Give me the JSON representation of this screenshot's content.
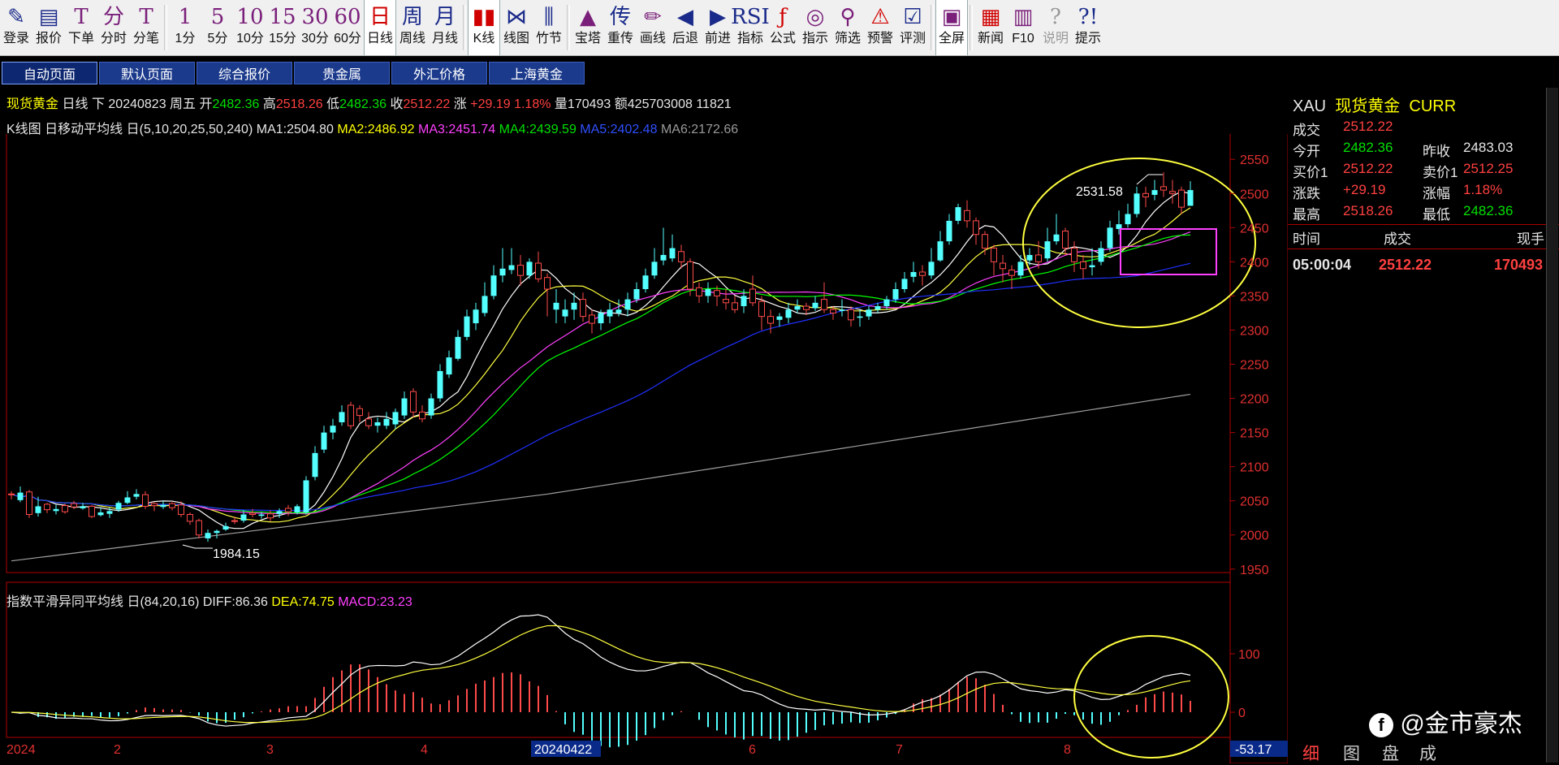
{
  "toolbar": {
    "buttons": [
      {
        "icon": "✎",
        "label": "登录",
        "name": "login",
        "style": "navy"
      },
      {
        "icon": "▤",
        "label": "报价",
        "name": "quote",
        "style": "navy"
      },
      {
        "icon": "T",
        "label": "下单",
        "name": "order",
        "style": ""
      },
      {
        "icon": "分",
        "label": "分时",
        "name": "intraday",
        "style": ""
      },
      {
        "icon": "T",
        "label": "分笔",
        "name": "ticks",
        "style": ""
      },
      {
        "icon": "1",
        "label": "1分",
        "name": "1min",
        "style": ""
      },
      {
        "icon": "5",
        "label": "5分",
        "name": "5min",
        "style": ""
      },
      {
        "icon": "10",
        "label": "10分",
        "name": "10min",
        "style": ""
      },
      {
        "icon": "15",
        "label": "15分",
        "name": "15min",
        "style": ""
      },
      {
        "icon": "30",
        "label": "30分",
        "name": "30min",
        "style": ""
      },
      {
        "icon": "60",
        "label": "60分",
        "name": "60min",
        "style": ""
      },
      {
        "icon": "日",
        "label": "日线",
        "name": "daily",
        "style": "red active"
      },
      {
        "icon": "周",
        "label": "周线",
        "name": "weekly",
        "style": "navy"
      },
      {
        "icon": "月",
        "label": "月线",
        "name": "monthly",
        "style": "navy"
      },
      {
        "icon": "▮▮",
        "label": "K线",
        "name": "kline",
        "style": "red active"
      },
      {
        "icon": "⋈",
        "label": "线图",
        "name": "linechart",
        "style": "navy"
      },
      {
        "icon": "⫼",
        "label": "竹节",
        "name": "bamboo",
        "style": "navy"
      },
      {
        "icon": "▲",
        "label": "宝塔",
        "name": "tower",
        "style": ""
      },
      {
        "icon": "传",
        "label": "重传",
        "name": "reload",
        "style": "navy"
      },
      {
        "icon": "✏",
        "label": "画线",
        "name": "draw",
        "style": ""
      },
      {
        "icon": "◀",
        "label": "后退",
        "name": "back",
        "style": "navy"
      },
      {
        "icon": "▶",
        "label": "前进",
        "name": "forward",
        "style": "navy"
      },
      {
        "icon": "RSI",
        "label": "指标",
        "name": "indicator",
        "style": "navy"
      },
      {
        "icon": "ƒ",
        "label": "公式",
        "name": "formula",
        "style": "red"
      },
      {
        "icon": "◎",
        "label": "指示",
        "name": "indicate",
        "style": ""
      },
      {
        "icon": "⚲",
        "label": "筛选",
        "name": "filter",
        "style": ""
      },
      {
        "icon": "⚠",
        "label": "预警",
        "name": "alert",
        "style": "red"
      },
      {
        "icon": "☑",
        "label": "评测",
        "name": "evaluate",
        "style": "navy"
      },
      {
        "icon": "▣",
        "label": "全屏",
        "name": "fullscreen",
        "style": "active"
      },
      {
        "icon": "▦",
        "label": "新闻",
        "name": "news",
        "style": "red"
      },
      {
        "icon": "▥",
        "label": "F10",
        "name": "f10",
        "style": ""
      },
      {
        "icon": "?",
        "label": "说明",
        "name": "help",
        "style": "grey"
      },
      {
        "icon": "?!",
        "label": "提示",
        "name": "tips",
        "style": "navy"
      }
    ]
  },
  "page_tabs": [
    "自动页面",
    "默认页面",
    "综合报价",
    "贵金属",
    "外汇价格",
    "上海黄金"
  ],
  "header": {
    "name": "现货黄金",
    "period": "日线",
    "dir": "下",
    "date": "20240823",
    "weekday": "周五",
    "open_label": "开",
    "open": "2482.36",
    "high_label": "高",
    "high": "2518.26",
    "low_label": "低",
    "low": "2482.36",
    "close_label": "收",
    "close": "2512.22",
    "chg_label": "涨",
    "chg": "+29.19",
    "chg_pct": "1.18%",
    "vol_label": "量",
    "vol": "170493",
    "amt_label": "额",
    "amt": "425703008",
    "extra": "11821"
  },
  "ma_line": {
    "prefix": "K线图",
    "ind": "日移动平均线",
    "params": "日(5,10,20,25,50,240)",
    "ma1": "MA1:2504.80",
    "ma2": "MA2:2486.92",
    "ma3": "MA3:2451.74",
    "ma4": "MA4:2439.59",
    "ma5": "MA5:2402.48",
    "ma6": "MA6:2172.66"
  },
  "macd_line": {
    "ind": "指数平滑异同平均线",
    "params": "日(84,20,16)",
    "diff": "DIFF:86.36",
    "dea": "DEA:74.75",
    "macd": "MACD:23.23"
  },
  "annotations": {
    "high_mark": "2531.58",
    "low_mark": "1984.15"
  },
  "x_labels": [
    {
      "text": "2024",
      "x": 8
    },
    {
      "text": "2",
      "x": 140
    },
    {
      "text": "3",
      "x": 328
    },
    {
      "text": "4",
      "x": 518
    },
    {
      "text": "20240422",
      "x": 658,
      "highlight": true
    },
    {
      "text": "6",
      "x": 922
    },
    {
      "text": "7",
      "x": 1103
    },
    {
      "text": "8",
      "x": 1310
    }
  ],
  "macd_axis": {
    "top": "100",
    "zero": "0",
    "bottom": "-53.17"
  },
  "quote": {
    "code": "XAU",
    "name": "现货黄金",
    "tag": "CURR",
    "last_label": "成交",
    "last": "2512.22",
    "open_label": "今开",
    "open": "2482.36",
    "prev_label": "昨收",
    "prev": "2483.03",
    "bid_label": "买价1",
    "bid": "2512.22",
    "ask_label": "卖价1",
    "ask": "2512.25",
    "chg_label": "涨跌",
    "chg": "+29.19",
    "pct_label": "涨幅",
    "pct": "1.18%",
    "high_label": "最高",
    "high": "2518.26",
    "low_label": "最低",
    "low": "2482.36"
  },
  "trades": {
    "headers": [
      "时间",
      "成交",
      "现手"
    ],
    "rows": [
      {
        "time": "05:00:04",
        "price": "2512.22",
        "vol": "170493"
      }
    ]
  },
  "bottom_tabs": [
    "细",
    "图",
    "盘",
    "成"
  ],
  "watermark": "@金市豪杰",
  "chart_data": {
    "type": "candlestick",
    "yticks": [
      1950,
      2000,
      2050,
      2100,
      2150,
      2200,
      2250,
      2300,
      2350,
      2400,
      2450,
      2500,
      2550
    ],
    "ylim": [
      1945,
      2580
    ],
    "candles": [
      [
        2060,
        2064,
        2052,
        2060
      ],
      [
        2062,
        2071,
        2048,
        2051
      ],
      [
        2030,
        2066,
        2025,
        2063
      ],
      [
        2042,
        2056,
        2027,
        2032
      ],
      [
        2037,
        2047,
        2032,
        2045
      ],
      [
        2038,
        2044,
        2030,
        2035
      ],
      [
        2034,
        2046,
        2031,
        2043
      ],
      [
        2041,
        2050,
        2038,
        2046
      ],
      [
        2042,
        2047,
        2037,
        2039
      ],
      [
        2027,
        2044,
        2025,
        2042
      ],
      [
        2033,
        2040,
        2027,
        2029
      ],
      [
        2035,
        2040,
        2025,
        2031
      ],
      [
        2047,
        2050,
        2034,
        2037
      ],
      [
        2055,
        2064,
        2045,
        2047
      ],
      [
        2060,
        2067,
        2052,
        2056
      ],
      [
        2042,
        2064,
        2038,
        2059
      ],
      [
        2043,
        2048,
        2035,
        2046
      ],
      [
        2044,
        2050,
        2038,
        2041
      ],
      [
        2040,
        2048,
        2036,
        2046
      ],
      [
        2030,
        2049,
        2026,
        2044
      ],
      [
        2020,
        2033,
        2015,
        2030
      ],
      [
        2000,
        2024,
        1995,
        2021
      ],
      [
        2003,
        2008,
        1990,
        1995
      ],
      [
        2006,
        2008,
        1995,
        2003
      ],
      [
        2013,
        2018,
        2006,
        2008
      ],
      [
        2020,
        2027,
        2016,
        2021
      ],
      [
        2030,
        2036,
        2018,
        2021
      ],
      [
        2030,
        2038,
        2026,
        2032
      ],
      [
        2030,
        2034,
        2024,
        2028
      ],
      [
        2025,
        2036,
        2020,
        2031
      ],
      [
        2035,
        2039,
        2025,
        2031
      ],
      [
        2034,
        2044,
        2028,
        2039
      ],
      [
        2042,
        2045,
        2030,
        2033
      ],
      [
        2080,
        2086,
        2030,
        2033
      ],
      [
        2120,
        2130,
        2080,
        2085
      ],
      [
        2150,
        2160,
        2120,
        2125
      ],
      [
        2160,
        2170,
        2140,
        2150
      ],
      [
        2180,
        2190,
        2160,
        2165
      ],
      [
        2160,
        2195,
        2155,
        2190
      ],
      [
        2175,
        2190,
        2165,
        2185
      ],
      [
        2160,
        2180,
        2155,
        2170
      ],
      [
        2165,
        2172,
        2150,
        2160
      ],
      [
        2170,
        2180,
        2155,
        2160
      ],
      [
        2180,
        2185,
        2155,
        2162
      ],
      [
        2200,
        2210,
        2170,
        2175
      ],
      [
        2180,
        2215,
        2172,
        2210
      ],
      [
        2170,
        2190,
        2165,
        2180
      ],
      [
        2200,
        2207,
        2170,
        2175
      ],
      [
        2240,
        2250,
        2195,
        2200
      ],
      [
        2260,
        2270,
        2230,
        2235
      ],
      [
        2290,
        2300,
        2255,
        2258
      ],
      [
        2320,
        2330,
        2285,
        2290
      ],
      [
        2330,
        2340,
        2300,
        2310
      ],
      [
        2350,
        2370,
        2320,
        2325
      ],
      [
        2380,
        2395,
        2345,
        2350
      ],
      [
        2390,
        2420,
        2370,
        2380
      ],
      [
        2395,
        2420,
        2382,
        2388
      ],
      [
        2380,
        2410,
        2365,
        2395
      ],
      [
        2400,
        2405,
        2375,
        2380
      ],
      [
        2375,
        2415,
        2370,
        2398
      ],
      [
        2360,
        2383,
        2320,
        2377
      ],
      [
        2340,
        2360,
        2310,
        2330
      ],
      [
        2330,
        2345,
        2310,
        2320
      ],
      [
        2340,
        2355,
        2315,
        2330
      ],
      [
        2320,
        2355,
        2312,
        2345
      ],
      [
        2310,
        2330,
        2295,
        2322
      ],
      [
        2325,
        2330,
        2300,
        2310
      ],
      [
        2330,
        2340,
        2310,
        2320
      ],
      [
        2330,
        2345,
        2320,
        2325
      ],
      [
        2345,
        2355,
        2320,
        2330
      ],
      [
        2360,
        2370,
        2340,
        2345
      ],
      [
        2380,
        2390,
        2355,
        2360
      ],
      [
        2400,
        2420,
        2375,
        2380
      ],
      [
        2410,
        2450,
        2395,
        2402
      ],
      [
        2420,
        2440,
        2400,
        2405
      ],
      [
        2400,
        2425,
        2390,
        2415
      ],
      [
        2360,
        2405,
        2350,
        2400
      ],
      [
        2350,
        2370,
        2340,
        2362
      ],
      [
        2360,
        2370,
        2340,
        2350
      ],
      [
        2350,
        2365,
        2335,
        2358
      ],
      [
        2340,
        2360,
        2330,
        2345
      ],
      [
        2330,
        2350,
        2325,
        2340
      ],
      [
        2350,
        2360,
        2325,
        2335
      ],
      [
        2340,
        2380,
        2335,
        2360
      ],
      [
        2320,
        2350,
        2300,
        2342
      ],
      [
        2310,
        2330,
        2295,
        2320
      ],
      [
        2320,
        2325,
        2305,
        2315
      ],
      [
        2330,
        2340,
        2310,
        2318
      ],
      [
        2335,
        2345,
        2325,
        2330
      ],
      [
        2330,
        2340,
        2322,
        2335
      ],
      [
        2340,
        2350,
        2328,
        2332
      ],
      [
        2330,
        2370,
        2325,
        2345
      ],
      [
        2325,
        2335,
        2315,
        2330
      ],
      [
        2330,
        2345,
        2320,
        2328
      ],
      [
        2315,
        2335,
        2305,
        2330
      ],
      [
        2320,
        2330,
        2305,
        2318
      ],
      [
        2330,
        2335,
        2315,
        2320
      ],
      [
        2335,
        2340,
        2325,
        2330
      ],
      [
        2345,
        2350,
        2330,
        2335
      ],
      [
        2360,
        2370,
        2340,
        2345
      ],
      [
        2375,
        2385,
        2355,
        2360
      ],
      [
        2385,
        2400,
        2370,
        2378
      ],
      [
        2380,
        2395,
        2365,
        2385
      ],
      [
        2400,
        2420,
        2375,
        2380
      ],
      [
        2430,
        2445,
        2400,
        2402
      ],
      [
        2460,
        2470,
        2425,
        2430
      ],
      [
        2480,
        2485,
        2455,
        2460
      ],
      [
        2460,
        2490,
        2450,
        2475
      ],
      [
        2440,
        2465,
        2425,
        2460
      ],
      [
        2420,
        2445,
        2410,
        2440
      ],
      [
        2400,
        2425,
        2380,
        2420
      ],
      [
        2390,
        2410,
        2370,
        2398
      ],
      [
        2380,
        2395,
        2360,
        2388
      ],
      [
        2400,
        2410,
        2375,
        2380
      ],
      [
        2410,
        2420,
        2395,
        2402
      ],
      [
        2400,
        2430,
        2390,
        2410
      ],
      [
        2430,
        2450,
        2400,
        2405
      ],
      [
        2440,
        2470,
        2425,
        2430
      ],
      [
        2420,
        2450,
        2410,
        2445
      ],
      [
        2400,
        2430,
        2385,
        2420
      ],
      [
        2390,
        2410,
        2375,
        2400
      ],
      [
        2395,
        2420,
        2380,
        2392
      ],
      [
        2420,
        2430,
        2395,
        2400
      ],
      [
        2450,
        2460,
        2415,
        2420
      ],
      [
        2455,
        2475,
        2440,
        2448
      ],
      [
        2470,
        2485,
        2450,
        2455
      ],
      [
        2500,
        2510,
        2465,
        2470
      ],
      [
        2495,
        2510,
        2480,
        2500
      ],
      [
        2505,
        2520,
        2490,
        2498
      ],
      [
        2505,
        2531,
        2495,
        2510
      ],
      [
        2500,
        2520,
        2485,
        2503
      ],
      [
        2480,
        2510,
        2470,
        2505
      ],
      [
        2505,
        2518,
        2482,
        2482
      ]
    ]
  }
}
